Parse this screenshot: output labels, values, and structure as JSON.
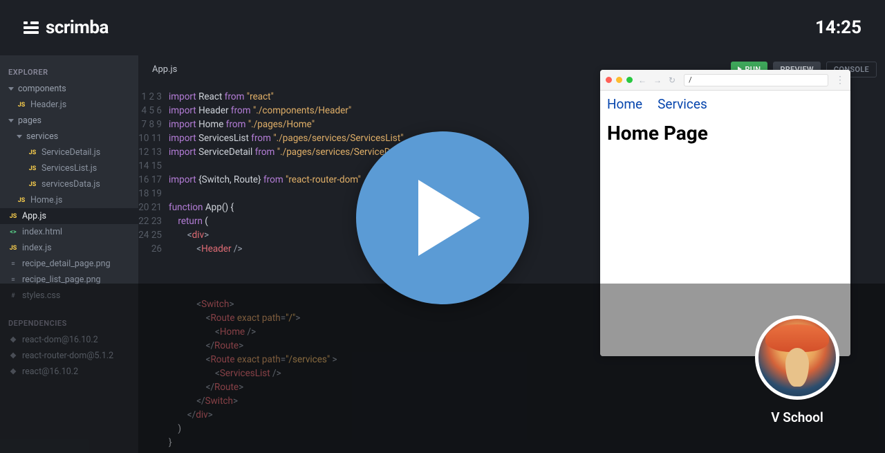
{
  "brand": "scrimba",
  "clock": "14:25",
  "explorer": {
    "heading": "EXPLORER",
    "tree": {
      "components": {
        "label": "components",
        "files": [
          "Header.js"
        ]
      },
      "pages": {
        "label": "pages",
        "services": {
          "label": "services",
          "files": [
            "ServiceDetail.js",
            "ServicesList.js",
            "servicesData.js"
          ]
        },
        "files": [
          "Home.js"
        ]
      },
      "root_files": [
        {
          "name": "App.js",
          "icon": "JS",
          "cls": "fc-js",
          "selected": true
        },
        {
          "name": "index.html",
          "icon": "<>",
          "cls": "fc-html"
        },
        {
          "name": "index.js",
          "icon": "JS",
          "cls": "fc-js"
        },
        {
          "name": "recipe_detail_page.png",
          "icon": "≡",
          "cls": "fc-img"
        },
        {
          "name": "recipe_list_page.png",
          "icon": "≡",
          "cls": "fc-img"
        },
        {
          "name": "styles.css",
          "icon": "#",
          "cls": "fc-css"
        }
      ]
    },
    "deps_heading": "DEPENDENCIES",
    "deps": [
      "react-dom@16.10.2",
      "react-router-dom@5.1.2",
      "react@16.10.2"
    ]
  },
  "tab": "App.js",
  "buttons": {
    "run": "RUN",
    "preview": "PREVIEW",
    "console": "CONSOLE"
  },
  "code_lines": 26,
  "preview": {
    "url": "/",
    "nav": [
      "Home",
      "Services"
    ],
    "heading": "Home Page"
  },
  "instructor": "V School",
  "code_tokens": [
    [
      [
        "kw",
        "import"
      ],
      [
        "id",
        " React "
      ],
      [
        "kw",
        "from"
      ],
      [
        "id",
        " "
      ],
      [
        "str",
        "\"react\""
      ]
    ],
    [
      [
        "kw",
        "import"
      ],
      [
        "id",
        " Header "
      ],
      [
        "kw",
        "from"
      ],
      [
        "id",
        " "
      ],
      [
        "str",
        "\"./components/Header\""
      ]
    ],
    [
      [
        "kw",
        "import"
      ],
      [
        "id",
        " Home "
      ],
      [
        "kw",
        "from"
      ],
      [
        "id",
        " "
      ],
      [
        "str",
        "\"./pages/Home\""
      ]
    ],
    [
      [
        "kw",
        "import"
      ],
      [
        "id",
        " ServicesList "
      ],
      [
        "kw",
        "from"
      ],
      [
        "id",
        " "
      ],
      [
        "str",
        "\"./pages/services/ServicesList\""
      ]
    ],
    [
      [
        "kw",
        "import"
      ],
      [
        "id",
        " ServiceDetail "
      ],
      [
        "kw",
        "from"
      ],
      [
        "id",
        " "
      ],
      [
        "str",
        "\"./pages/services/ServiceDetail\""
      ]
    ],
    [],
    [
      [
        "kw",
        "import"
      ],
      [
        "id",
        " {Switch, Route} "
      ],
      [
        "kw",
        "from"
      ],
      [
        "id",
        " "
      ],
      [
        "str",
        "\"react-router-dom\""
      ]
    ],
    [],
    [
      [
        "fn",
        "function"
      ],
      [
        "id",
        " App() {"
      ]
    ],
    [
      [
        "id",
        "    "
      ],
      [
        "ret",
        "return"
      ],
      [
        "id",
        " ("
      ]
    ],
    [
      [
        "id",
        "        "
      ],
      [
        "punc",
        "<"
      ],
      [
        "tag",
        "div"
      ],
      [
        "punc",
        ">"
      ]
    ],
    [
      [
        "id",
        "            "
      ],
      [
        "punc",
        "<"
      ],
      [
        "tag",
        "Header"
      ],
      [
        "id",
        " "
      ],
      [
        "punc",
        "/>"
      ]
    ],
    [],
    [
      [
        "id",
        "            "
      ]
    ],
    [],
    [
      [
        "id",
        "            "
      ],
      [
        "punc",
        "<"
      ],
      [
        "tag",
        "Switch"
      ],
      [
        "punc",
        ">"
      ]
    ],
    [
      [
        "id",
        "                "
      ],
      [
        "punc",
        "<"
      ],
      [
        "tag",
        "Route"
      ],
      [
        "id",
        " "
      ],
      [
        "attr",
        "exact"
      ],
      [
        "id",
        " "
      ],
      [
        "attr",
        "path"
      ],
      [
        "punc",
        "="
      ],
      [
        "str",
        "\"/\""
      ],
      [
        "punc",
        ">"
      ]
    ],
    [
      [
        "id",
        "                    "
      ],
      [
        "punc",
        "<"
      ],
      [
        "tag",
        "Home"
      ],
      [
        "id",
        " "
      ],
      [
        "punc",
        "/>"
      ]
    ],
    [
      [
        "id",
        "                "
      ],
      [
        "punc",
        "</"
      ],
      [
        "tag",
        "Route"
      ],
      [
        "punc",
        ">"
      ]
    ],
    [
      [
        "id",
        "                "
      ],
      [
        "punc",
        "<"
      ],
      [
        "tag",
        "Route"
      ],
      [
        "id",
        " "
      ],
      [
        "attr",
        "exact"
      ],
      [
        "id",
        " "
      ],
      [
        "attr",
        "path"
      ],
      [
        "punc",
        "="
      ],
      [
        "str",
        "\"/services\""
      ],
      [
        "id",
        " "
      ],
      [
        "punc",
        ">"
      ]
    ],
    [
      [
        "id",
        "                    "
      ],
      [
        "punc",
        "<"
      ],
      [
        "tag",
        "ServicesList"
      ],
      [
        "id",
        " "
      ],
      [
        "punc",
        "/>"
      ]
    ],
    [
      [
        "id",
        "                "
      ],
      [
        "punc",
        "</"
      ],
      [
        "tag",
        "Route"
      ],
      [
        "punc",
        ">"
      ]
    ],
    [
      [
        "id",
        "            "
      ],
      [
        "punc",
        "</"
      ],
      [
        "tag",
        "Switch"
      ],
      [
        "punc",
        ">"
      ]
    ],
    [
      [
        "id",
        "        "
      ],
      [
        "punc",
        "</"
      ],
      [
        "tag",
        "div"
      ],
      [
        "punc",
        ">"
      ]
    ],
    [
      [
        "id",
        "    )"
      ]
    ],
    [
      [
        "id",
        "}"
      ]
    ]
  ]
}
